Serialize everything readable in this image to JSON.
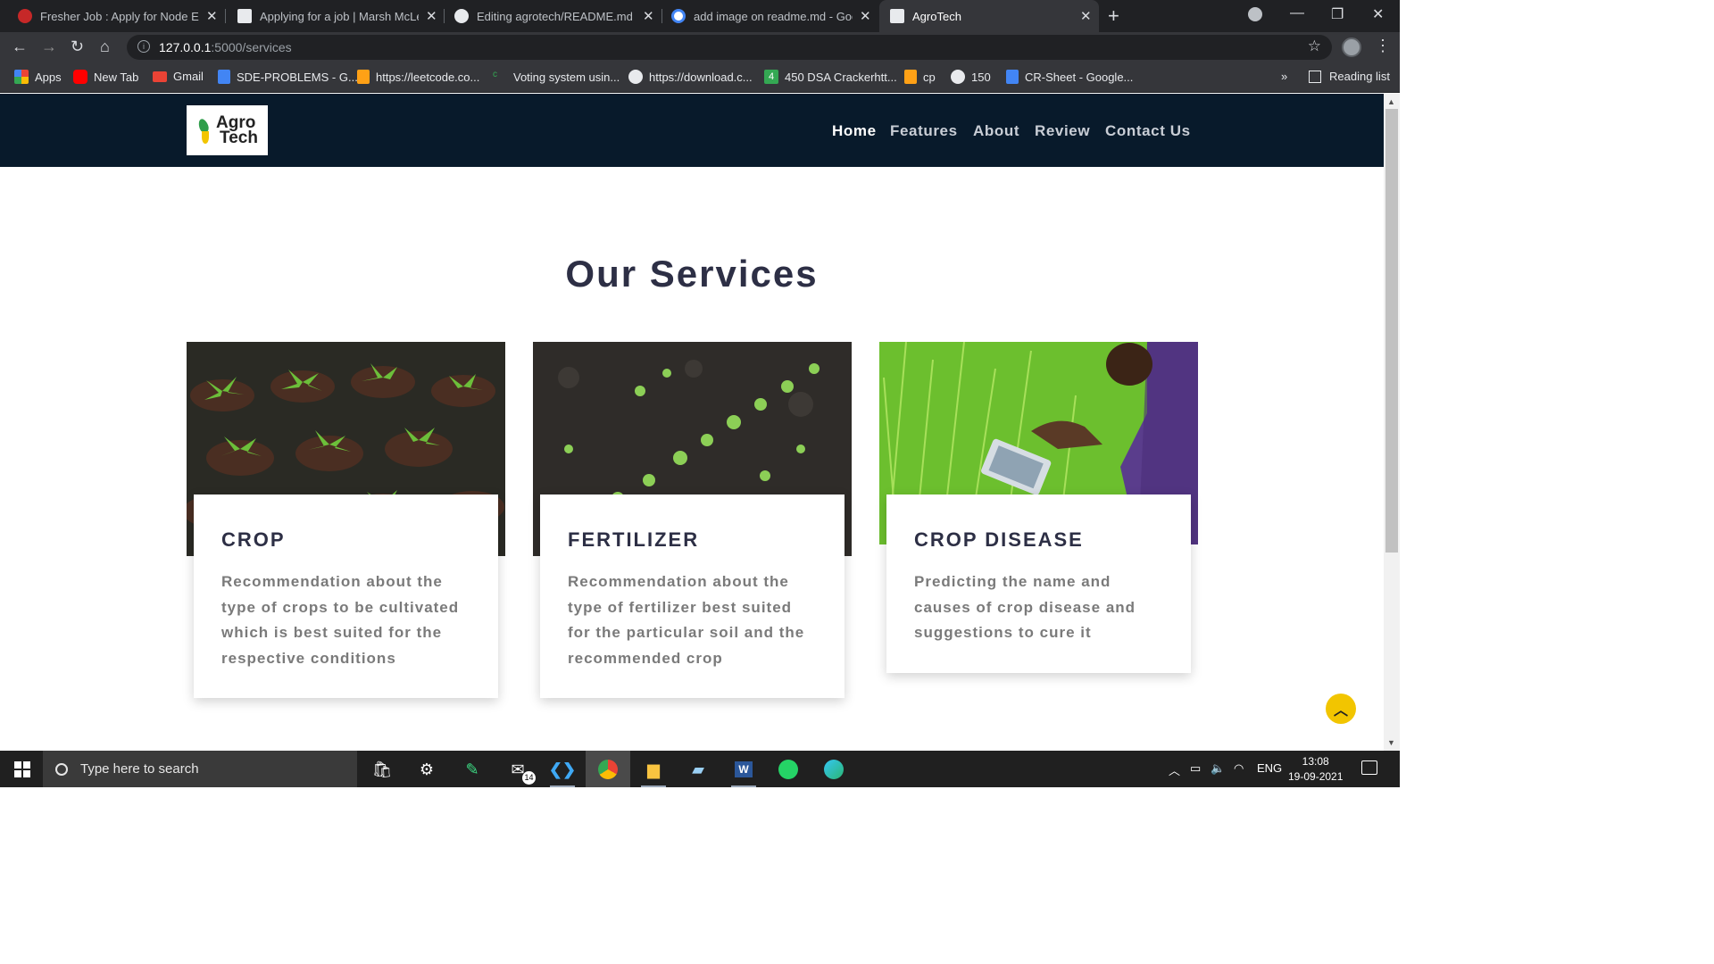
{
  "browser": {
    "tabs": [
      {
        "title": "Fresher Job : Apply for Node Eng",
        "icon": "fresher-favicon",
        "active": false
      },
      {
        "title": "Applying for a job | Marsh McLen",
        "icon": "briefcase-favicon",
        "active": false
      },
      {
        "title": "Editing agrotech/README.md at",
        "icon": "github-favicon",
        "active": false
      },
      {
        "title": "add image on readme.md - Goo",
        "icon": "google-favicon",
        "active": false
      },
      {
        "title": "AgroTech",
        "icon": "agrotech-favicon",
        "active": true
      }
    ],
    "url_host": "127.0.0.1",
    "url_path": ":5000/services",
    "bookmarks": [
      {
        "label": "Apps",
        "icon": "apps-grid-icon",
        "color": "#ea4335"
      },
      {
        "label": "New Tab",
        "icon": "youtube-icon",
        "color": "#ff0000"
      },
      {
        "label": "Gmail",
        "icon": "gmail-icon",
        "color": "#ea4335"
      },
      {
        "label": "SDE-PROBLEMS - G...",
        "icon": "google-docs-icon",
        "color": "#4285f4"
      },
      {
        "label": "https://leetcode.co...",
        "icon": "leetcode-icon",
        "color": "#ffa116"
      },
      {
        "label": "Voting system usin...",
        "icon": "c-icon",
        "color": "#35363a"
      },
      {
        "label": "https://download.c...",
        "icon": "globe-icon",
        "color": "#e8eaed"
      },
      {
        "label": "450 DSA Crackerhtt...",
        "icon": "sheets-4-icon",
        "color": "#34a853"
      },
      {
        "label": "cp",
        "icon": "leetcode-icon",
        "color": "#ffa116"
      },
      {
        "label": "150",
        "icon": "globe-icon",
        "color": "#e8eaed"
      },
      {
        "label": "CR-Sheet - Google...",
        "icon": "google-docs-icon",
        "color": "#4285f4"
      }
    ],
    "bookmarks_more": "»",
    "reading_list": "Reading list"
  },
  "site": {
    "logo_line1": "Agro",
    "logo_line2": "Tech",
    "nav": [
      "Home",
      "Features",
      "About",
      "Review",
      "Contact Us"
    ],
    "active_nav": "Home",
    "section_title": "Our Services",
    "cards": [
      {
        "title": "CROP",
        "description": "Recommendation about the type of crops to be cultivated which is best suited for the respective conditions",
        "image": "seedlings-in-pots"
      },
      {
        "title": "FERTILIZER",
        "description": "Recommendation about the type of fertilizer best suited for the particular soil and the recommended crop",
        "image": "sprouts-in-soil"
      },
      {
        "title": "CROP DISEASE",
        "description": "Predicting the name and causes of crop disease and suggestions to cure it",
        "image": "farmer-with-tablet-in-field"
      }
    ],
    "accent": "#f2c500",
    "nav_bg": "#081a2b",
    "heading_color": "#2d2f45"
  },
  "taskbar": {
    "search_placeholder": "Type here to search",
    "mail_badge": "14",
    "language": "ENG",
    "time": "13:08",
    "date": "19-09-2021"
  }
}
